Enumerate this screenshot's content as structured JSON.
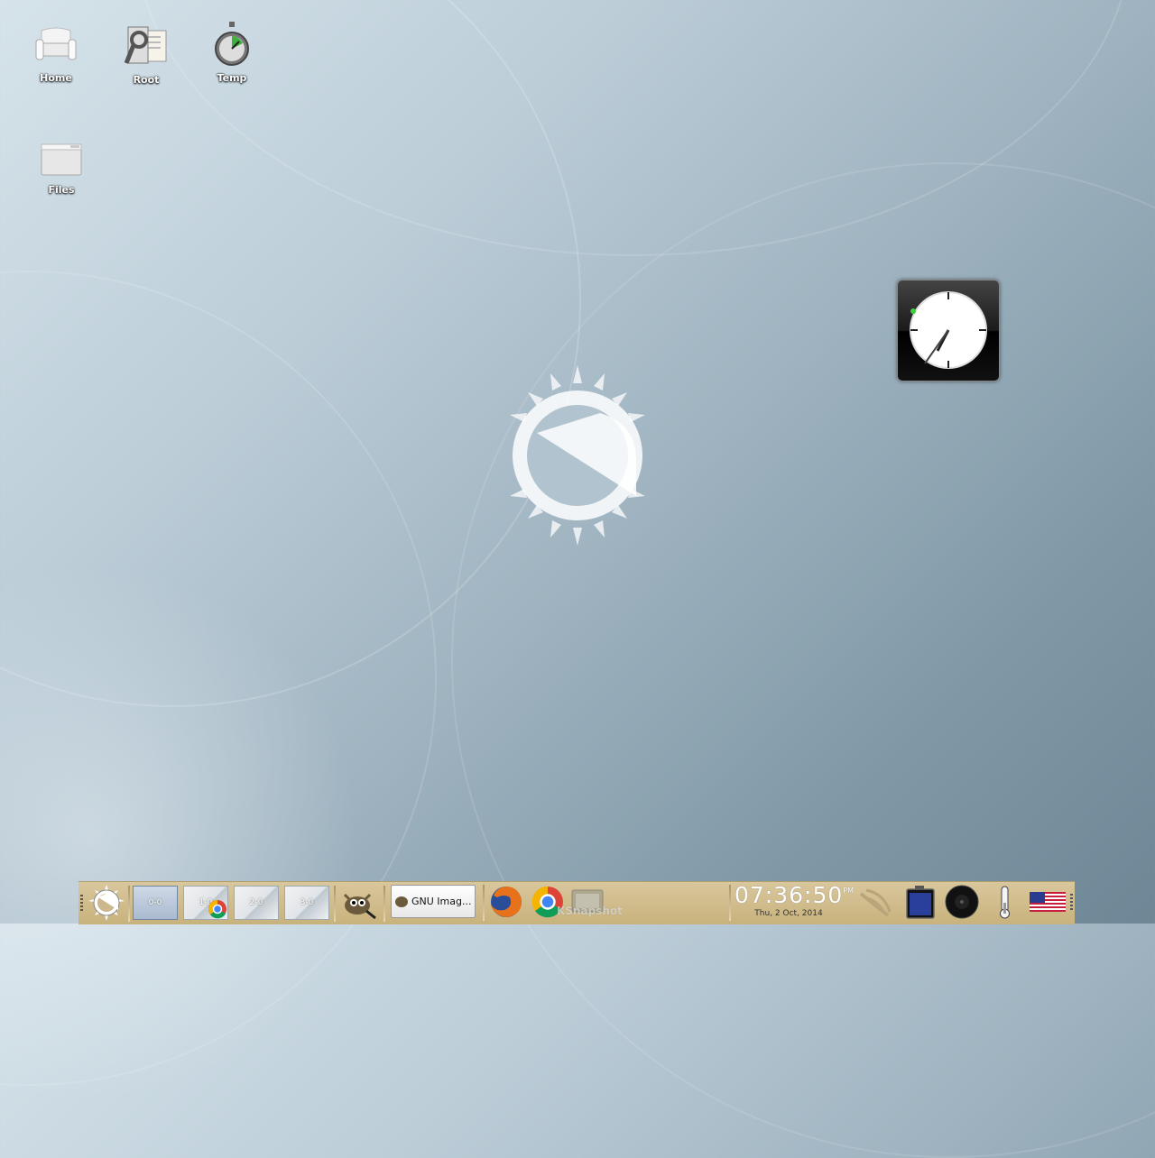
{
  "desktop": {
    "icons": [
      {
        "label": "Home"
      },
      {
        "label": "Root"
      },
      {
        "label": "Temp"
      },
      {
        "label": "Files"
      }
    ]
  },
  "shelf": {
    "pager": [
      "0-0",
      "1-0",
      "2-0",
      "3-0"
    ],
    "active_desk": "0-0",
    "task": {
      "label": "GNU Imag..."
    },
    "launcher_ghost_label": "KSnapshot",
    "clock": {
      "time": "07:36:50",
      "ampm": "PM",
      "date": "Thu,  2 Oct, 2014"
    }
  },
  "colors": {
    "shelf": "#d3bf8f",
    "accent": "#2a3f9a"
  },
  "icons": [
    "start-menu-icon",
    "gimp-icon",
    "firefox-icon",
    "chrome-icon",
    "ksnapshot-icon",
    "wifi-icon",
    "battery-icon",
    "mixer-icon",
    "temperature-icon",
    "us-flag-icon"
  ]
}
